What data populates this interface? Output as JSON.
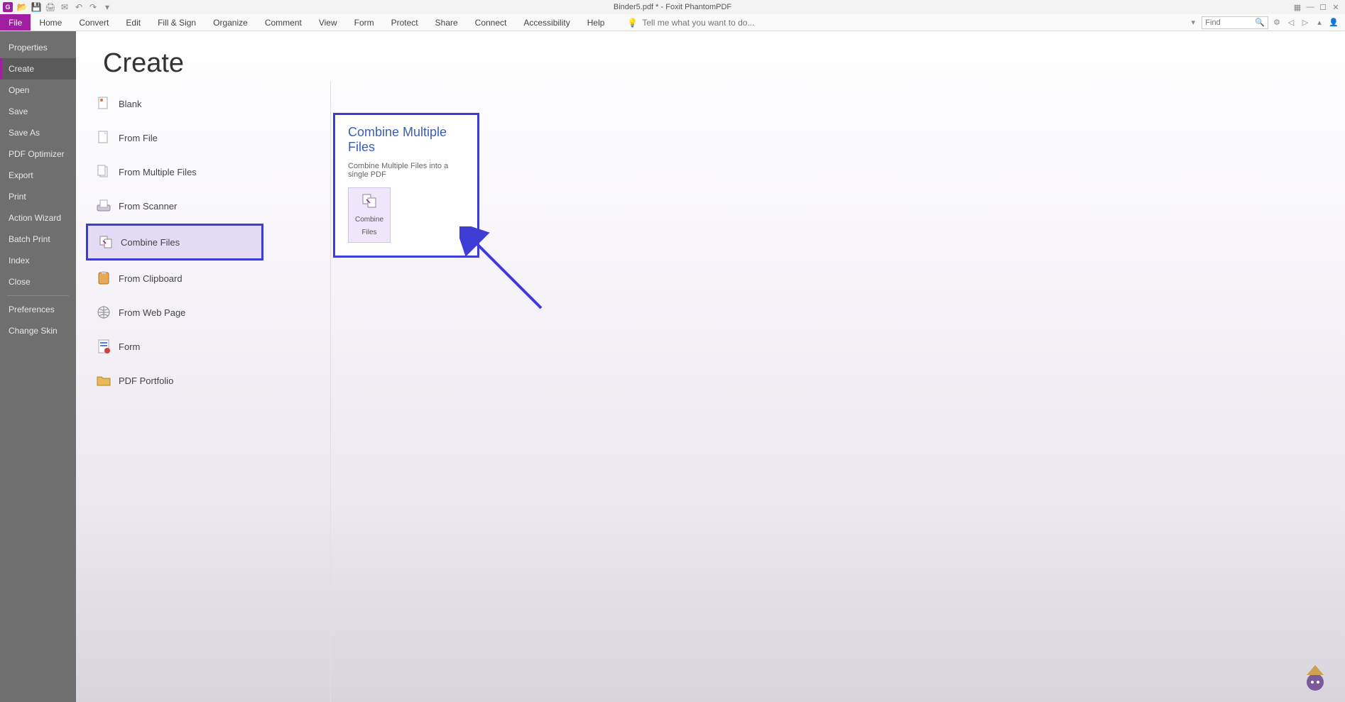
{
  "titlebar": {
    "title": "Binder5.pdf * - Foxit PhantomPDF"
  },
  "ribbon": {
    "tabs": [
      "File",
      "Home",
      "Convert",
      "Edit",
      "Fill & Sign",
      "Organize",
      "Comment",
      "View",
      "Form",
      "Protect",
      "Share",
      "Connect",
      "Accessibility",
      "Help"
    ],
    "tellme_placeholder": "Tell me what you want to do...",
    "find_placeholder": "Find"
  },
  "sidebar": {
    "items": [
      "Properties",
      "Create",
      "Open",
      "Save",
      "Save As",
      "PDF Optimizer",
      "Export",
      "Print",
      "Action Wizard",
      "Batch Print",
      "Index",
      "Close",
      "Preferences",
      "Change Skin"
    ],
    "active_index": 1,
    "divider_after_index": 11
  },
  "main": {
    "heading": "Create",
    "options": [
      {
        "label": "Blank"
      },
      {
        "label": "From File"
      },
      {
        "label": "From Multiple Files"
      },
      {
        "label": "From Scanner"
      },
      {
        "label": "Combine Files"
      },
      {
        "label": "From Clipboard"
      },
      {
        "label": "From Web Page"
      },
      {
        "label": "Form"
      },
      {
        "label": "PDF Portfolio"
      }
    ],
    "highlighted_index": 4
  },
  "detail": {
    "title": "Combine Multiple Files",
    "description": "Combine Multiple Files into a single PDF",
    "button_label": "Combine Files"
  }
}
